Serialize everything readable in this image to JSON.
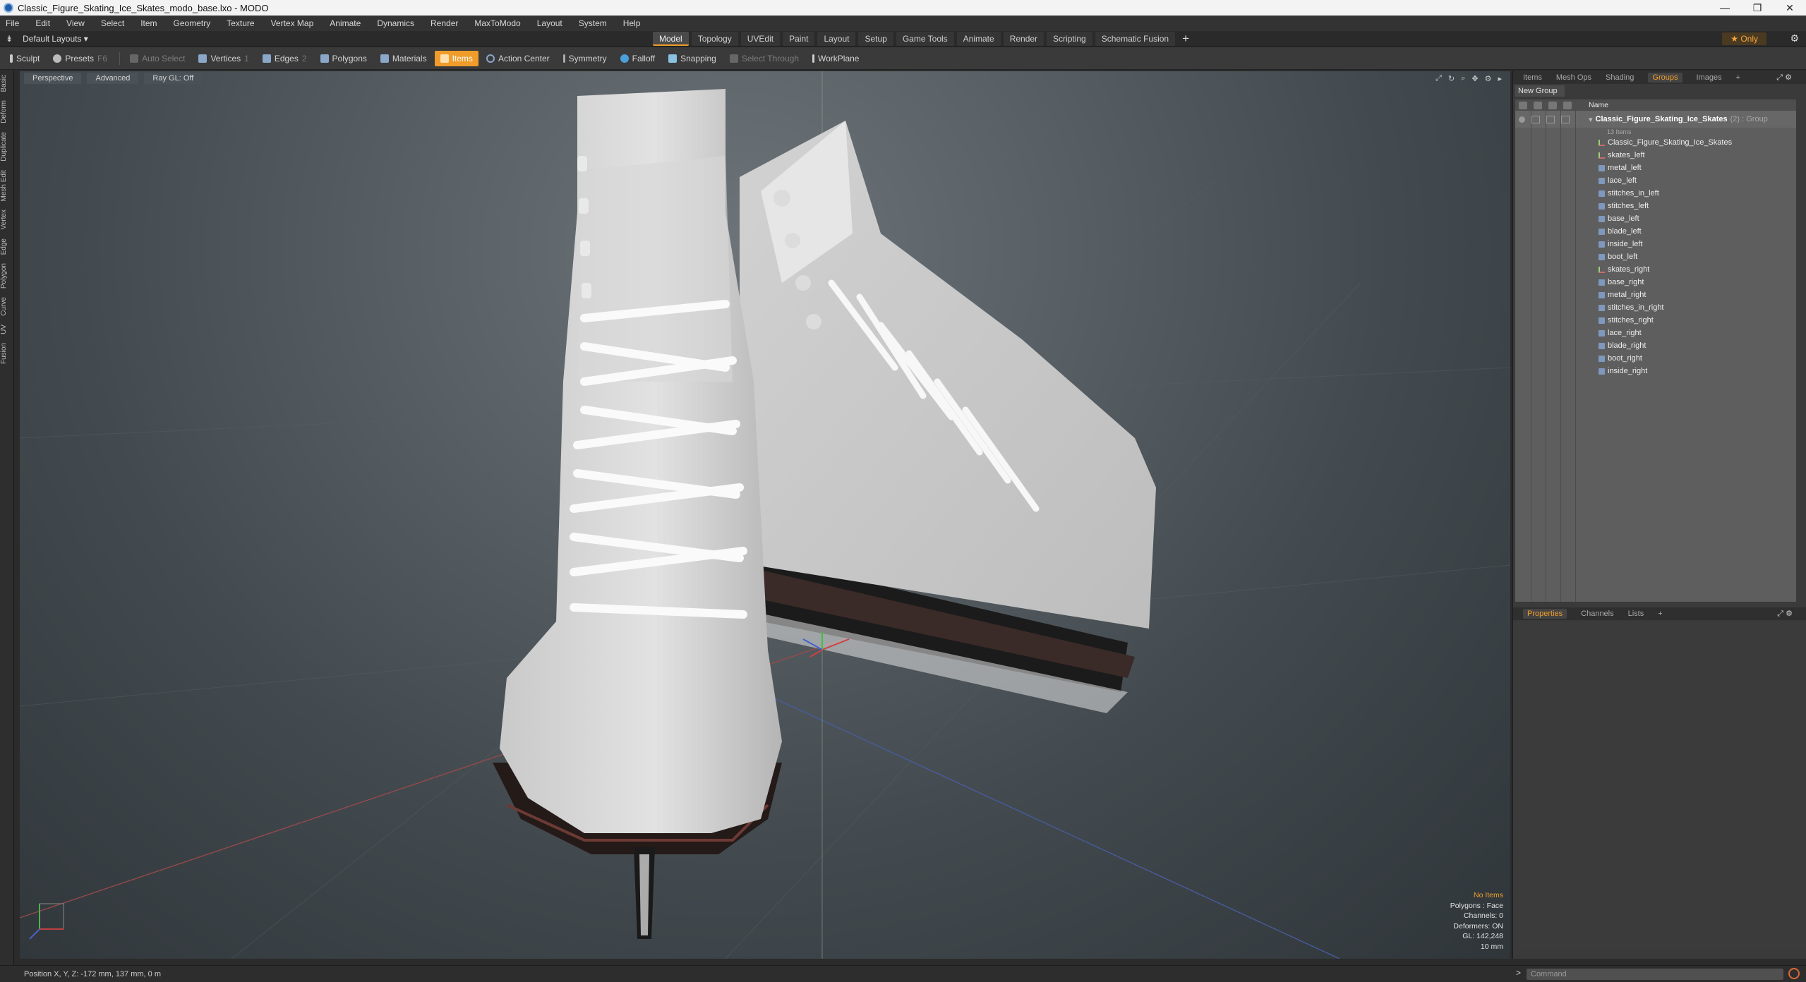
{
  "window": {
    "title": "Classic_Figure_Skating_Ice_Skates_modo_base.lxo - MODO",
    "controls": [
      "—",
      "❐",
      "✕"
    ]
  },
  "menu": [
    "File",
    "Edit",
    "View",
    "Select",
    "Item",
    "Geometry",
    "Texture",
    "Vertex Map",
    "Animate",
    "Dynamics",
    "Render",
    "MaxToModo",
    "Layout",
    "System",
    "Help"
  ],
  "layoutbar": {
    "layout_selector": "Default Layouts ▾",
    "tabs": [
      "Model",
      "Topology",
      "UVEdit",
      "Paint",
      "Layout",
      "Setup",
      "Game Tools",
      "Animate",
      "Render",
      "Scripting",
      "Schematic Fusion"
    ],
    "active_tab": "Model",
    "add": "+",
    "only": "★ Only"
  },
  "toolbar": {
    "sculpt": "Sculpt",
    "presets": "Presets",
    "presets_key": "F6",
    "auto_select": "Auto Select",
    "vertices": "Vertices",
    "vertices_key": "1",
    "edges": "Edges",
    "edges_key": "2",
    "polygons": "Polygons",
    "materials": "Materials",
    "items": "Items",
    "action_center": "Action Center",
    "symmetry": "Symmetry",
    "falloff": "Falloff",
    "snapping": "Snapping",
    "select_through": "Select Through",
    "workplane": "WorkPlane"
  },
  "left_tabs": [
    "Basic",
    "Deform",
    "Duplicate",
    "Mesh Edit",
    "Vertex",
    "Edge",
    "Polygon",
    "Curve",
    "UV",
    "Fusion"
  ],
  "viewport": {
    "view_mode": "Perspective",
    "shading": "Advanced",
    "raygl": "Ray GL: Off",
    "info": {
      "selection": "No Items",
      "polygons": "Polygons : Face",
      "channels": "Channels: 0",
      "deformers": "Deformers: ON",
      "gl": "GL: 142,248",
      "scale": "10 mm"
    }
  },
  "panel_top": {
    "tabs": [
      "Items",
      "Mesh Ops",
      "Shading",
      "Groups",
      "Images"
    ],
    "active_tab": "Groups",
    "new_group": "New Group",
    "column_name": "Name",
    "group": {
      "name": "Classic_Figure_Skating_Ice_Skates",
      "suffix": "(2) : Group",
      "sub": "13 Items"
    },
    "items": [
      {
        "label": "Classic_Figure_Skating_Ice_Skates",
        "kind": "locator"
      },
      {
        "label": "skates_left",
        "kind": "locator"
      },
      {
        "label": "metal_left",
        "kind": "mesh"
      },
      {
        "label": "lace_left",
        "kind": "mesh"
      },
      {
        "label": "stitches_in_left",
        "kind": "mesh"
      },
      {
        "label": "stitches_left",
        "kind": "mesh"
      },
      {
        "label": "base_left",
        "kind": "mesh"
      },
      {
        "label": "blade_left",
        "kind": "mesh"
      },
      {
        "label": "inside_left",
        "kind": "mesh"
      },
      {
        "label": "boot_left",
        "kind": "mesh"
      },
      {
        "label": "skates_right",
        "kind": "locator"
      },
      {
        "label": "base_right",
        "kind": "mesh"
      },
      {
        "label": "metal_right",
        "kind": "mesh"
      },
      {
        "label": "stitches_in_right",
        "kind": "mesh"
      },
      {
        "label": "stitches_right",
        "kind": "mesh"
      },
      {
        "label": "lace_right",
        "kind": "mesh"
      },
      {
        "label": "blade_right",
        "kind": "mesh"
      },
      {
        "label": "boot_right",
        "kind": "mesh"
      },
      {
        "label": "inside_right",
        "kind": "mesh"
      }
    ]
  },
  "panel_bottom": {
    "tabs": [
      "Properties",
      "Channels",
      "Lists"
    ],
    "active_tab": "Properties",
    "add": "+"
  },
  "status": {
    "position": "Position X, Y, Z:  -172 mm, 137 mm, 0 m",
    "command_placeholder": "Command",
    "prompt": ">"
  },
  "colors": {
    "accent": "#f09c2a",
    "viewport_bg": "#4a5156",
    "skate_boot": "#d9d9d9"
  }
}
